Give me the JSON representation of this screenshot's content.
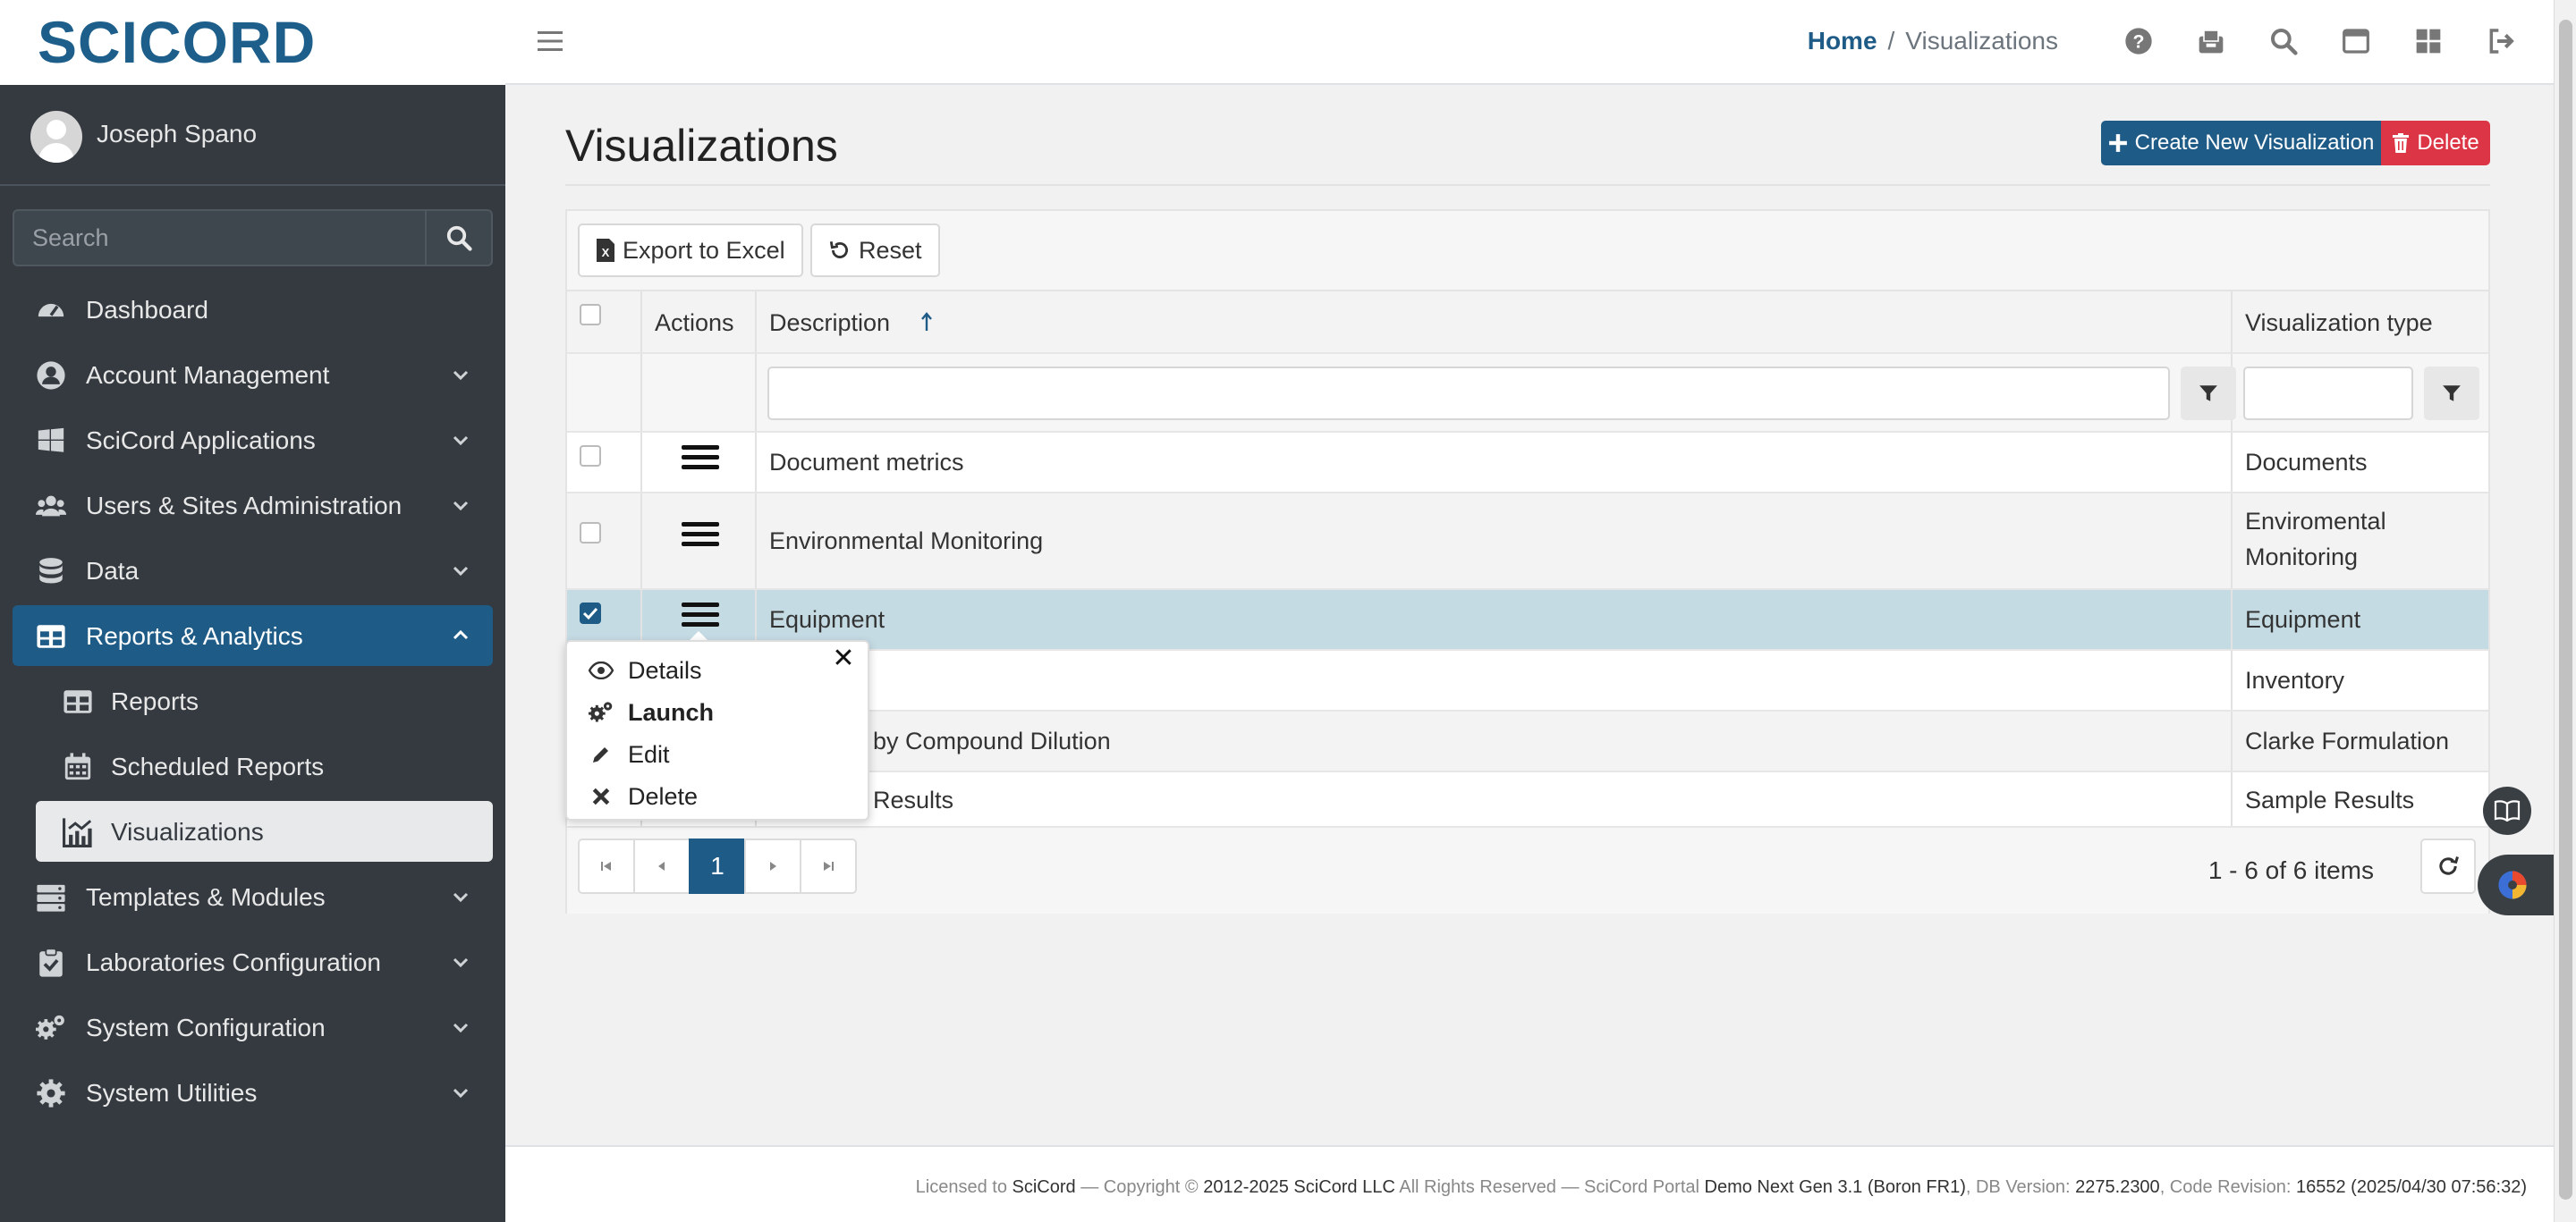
{
  "app": {
    "logo": "SCICORD",
    "user_name": "Joseph Spano"
  },
  "sidebar": {
    "search_placeholder": "Search",
    "items": [
      {
        "label": "Dashboard",
        "icon": "tachometer-icon"
      },
      {
        "label": "Account Management",
        "icon": "user-circle-icon"
      },
      {
        "label": "SciCord Applications",
        "icon": "windows-icon"
      },
      {
        "label": "Users & Sites Administration",
        "icon": "users-icon"
      },
      {
        "label": "Data",
        "icon": "database-icon"
      },
      {
        "label": "Reports & Analytics",
        "icon": "table-icon"
      },
      {
        "label": "Reports",
        "icon": "table-icon"
      },
      {
        "label": "Scheduled Reports",
        "icon": "calendar-icon"
      },
      {
        "label": "Visualizations",
        "icon": "chart-icon"
      },
      {
        "label": "Templates & Modules",
        "icon": "server-icon"
      },
      {
        "label": "Laboratories Configuration",
        "icon": "clipboard-check-icon"
      },
      {
        "label": "System Configuration",
        "icon": "cogs-icon"
      },
      {
        "label": "System Utilities",
        "icon": "cog-icon"
      }
    ]
  },
  "header": {
    "breadcrumb_home": "Home",
    "breadcrumb_sep": "/",
    "breadcrumb_current": "Visualizations"
  },
  "page": {
    "title": "Visualizations",
    "create_label": "Create New Visualization",
    "delete_label": "Delete"
  },
  "grid": {
    "toolbar": {
      "export_label": "Export to Excel",
      "reset_label": "Reset"
    },
    "columns": {
      "actions": "Actions",
      "description": "Description",
      "type": "Visualization type"
    },
    "rows": [
      {
        "description": "Document metrics",
        "type_line1": "Documents",
        "type_line2": "",
        "checked": false
      },
      {
        "description": "Environmental Monitoring",
        "type_line1": "Enviromental",
        "type_line2": "Monitoring",
        "checked": false
      },
      {
        "description": "Equipment",
        "type_line1": "Equipment",
        "type_line2": "",
        "checked": true
      },
      {
        "description": "",
        "type_line1": "Inventory",
        "type_line2": "",
        "checked": false
      },
      {
        "description": "by Compound Dilution",
        "type_line1": "Clarke Formulation",
        "type_line2": "",
        "checked": false
      },
      {
        "description": "Results",
        "type_line1": "Sample Results",
        "type_line2": "",
        "checked": false
      }
    ],
    "pager": {
      "current_page": "1",
      "info": "1 - 6 of 6 items"
    }
  },
  "popup_menu": {
    "items": [
      {
        "label": "Details",
        "icon": "eye-icon"
      },
      {
        "label": "Launch",
        "icon": "cogs-icon"
      },
      {
        "label": "Edit",
        "icon": "pencil-icon"
      },
      {
        "label": "Delete",
        "icon": "times-icon"
      }
    ],
    "close": "✕"
  },
  "footer": {
    "licensed_prefix": "Licensed to",
    "licensee": "SciCord",
    "copyright_prefix": "— Copyright ©",
    "copyright_holder": "2012-2025 SciCord LLC",
    "rights": "All Rights Reserved — SciCord Portal",
    "portal_name": "Demo Next Gen 3.1 (Boron FR1)",
    "db_prefix": ", DB Version:",
    "db_version": "2275.2300",
    "rev_prefix": ", Code Revision:",
    "code_revision": "16552 (2025/04/30 07:56:32)"
  },
  "colors": {
    "brand": "#1e5b86",
    "danger": "#dc3545",
    "sidebar_bg": "#343a40",
    "selected_row": "#c5dbe4"
  }
}
